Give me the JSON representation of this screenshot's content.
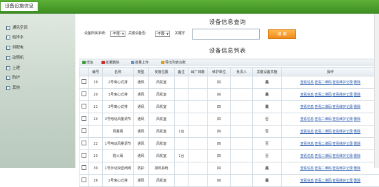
{
  "header": {
    "tab_title": "设备设施信息"
  },
  "sidebar": {
    "items": [
      {
        "label": "通风空调"
      },
      {
        "label": "给排水"
      },
      {
        "label": "供配电"
      },
      {
        "label": "动照机"
      },
      {
        "label": "土建"
      },
      {
        "label": "防护"
      },
      {
        "label": "其他"
      }
    ]
  },
  "search": {
    "title": "设备信息查询",
    "type_label": "设备所属系统:",
    "type_value": "-不限-",
    "key_label": "关键设备否:",
    "key_value": "-不限-",
    "keyword_label": "关键字",
    "keyword_value": "",
    "button_label": "搜 索"
  },
  "list": {
    "title": "设备信息列表",
    "toolbar": {
      "add": "增加",
      "batch_delete": "批量删除",
      "batch_upload": "批量上传",
      "export": "导出列表台账"
    },
    "columns": [
      "",
      "编号",
      "名称",
      "类型",
      "安装位置",
      "备注",
      "出厂日期",
      "维护单位",
      "负责人",
      "关键设备实施",
      "操作"
    ],
    "op_links": [
      "查看信息",
      "查看二维码",
      "查看维护记录",
      "删除"
    ],
    "rows": [
      {
        "id": "19",
        "name": "2号离心式排",
        "type": "通风",
        "location": "风机室",
        "remark": "",
        "date": "",
        "unit": "四",
        "owner": "",
        "key": "是"
      },
      {
        "id": "20",
        "name": "1号离心式排",
        "type": "通风",
        "location": "风机室",
        "remark": "",
        "date": "",
        "unit": "四",
        "owner": "",
        "key": "是"
      },
      {
        "id": "21",
        "name": "3号离心式排",
        "type": "通风",
        "location": "风机室",
        "remark": "",
        "date": "",
        "unit": "四",
        "owner": "",
        "key": "是"
      },
      {
        "id": "24",
        "name": "2号电动风量调节",
        "type": "通风",
        "location": "风机室",
        "remark": "",
        "date": "",
        "unit": "四",
        "owner": "",
        "key": "否"
      },
      {
        "id": "",
        "name": "风量阀",
        "type": "通风",
        "location": "风机室",
        "remark": "2台",
        "date": "",
        "unit": "四",
        "owner": "",
        "key": "否"
      },
      {
        "id": "22",
        "name": "1号电动风量调节",
        "type": "通风",
        "location": "风机室",
        "remark": "",
        "date": "",
        "unit": "四",
        "owner": "",
        "key": "否"
      },
      {
        "id": "23",
        "name": "防火阀",
        "type": "通风",
        "location": "风机室",
        "remark": "1台",
        "date": "",
        "unit": "四",
        "owner": "",
        "key": "否"
      },
      {
        "id": "30",
        "name": "1号手动双密闭阀",
        "type": "防护",
        "location": "排风系统",
        "remark": "",
        "date": "",
        "unit": "四",
        "owner": "",
        "key": "是"
      },
      {
        "id": "26",
        "name": "2号离心式排",
        "type": "通风",
        "location": "风机室",
        "remark": "",
        "date": "",
        "unit": "四",
        "owner": "",
        "key": "是"
      }
    ]
  },
  "colors": {
    "header_green": "#4fa22d",
    "search_button": "#f5962a",
    "link_blue": "#2a5db0",
    "key_yes": "#1a8a1a"
  }
}
